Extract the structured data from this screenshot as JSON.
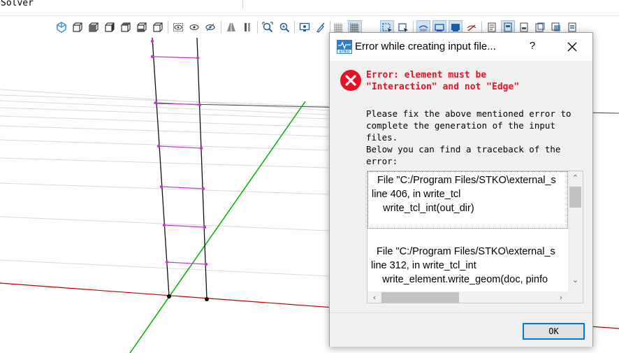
{
  "menubar": {
    "label": "Solver"
  },
  "toolbar": {
    "items": [
      "view-iso-icon",
      "view-front-icon",
      "view-back-icon",
      "view-left-icon",
      "view-right-icon",
      "view-top-icon",
      "view-bottom-icon",
      "hide-icon",
      "show-icon",
      "show-only-icon",
      "perspective-icon",
      "parallel-icon",
      "zoom-fit-icon",
      "zoom-window-icon",
      "screenshot-icon",
      "pick-icon",
      "grid-icon",
      "grid-select-icon",
      "select-box-icon",
      "select-icon",
      "visibility-a-icon",
      "visibility-b-icon",
      "visibility-c-icon",
      "visibility-d-icon",
      "layer-a-icon",
      "layer-b-icon",
      "layer-c-icon",
      "layer-d-icon",
      "layer-e-icon"
    ]
  },
  "dialog": {
    "title": "Error while creating input file...",
    "help_label": "?",
    "error_message": "Error: element must be\n\"Interaction\" and not \"Edge\"",
    "info_message": "Please fix the above mentioned error to\ncomplete the generation of the input\nfiles.\nBelow you can find a traceback of the\nerror:",
    "traceback": [
      "  File \"C:/Program Files/STKO\\external_s\nline 406, in write_tcl\n    write_tcl_int(out_dir)",
      "  File \"C:/Program Files/STKO\\external_s\nline 312, in write_tcl_int\n    write_element.write_geom(doc, pinfo"
    ],
    "ok_label": "OK"
  },
  "colors": {
    "error": "#e81123",
    "axis_x": "#c00000",
    "axis_y": "#00b000",
    "links": "#cc33cc",
    "accent": "#0078d7"
  }
}
